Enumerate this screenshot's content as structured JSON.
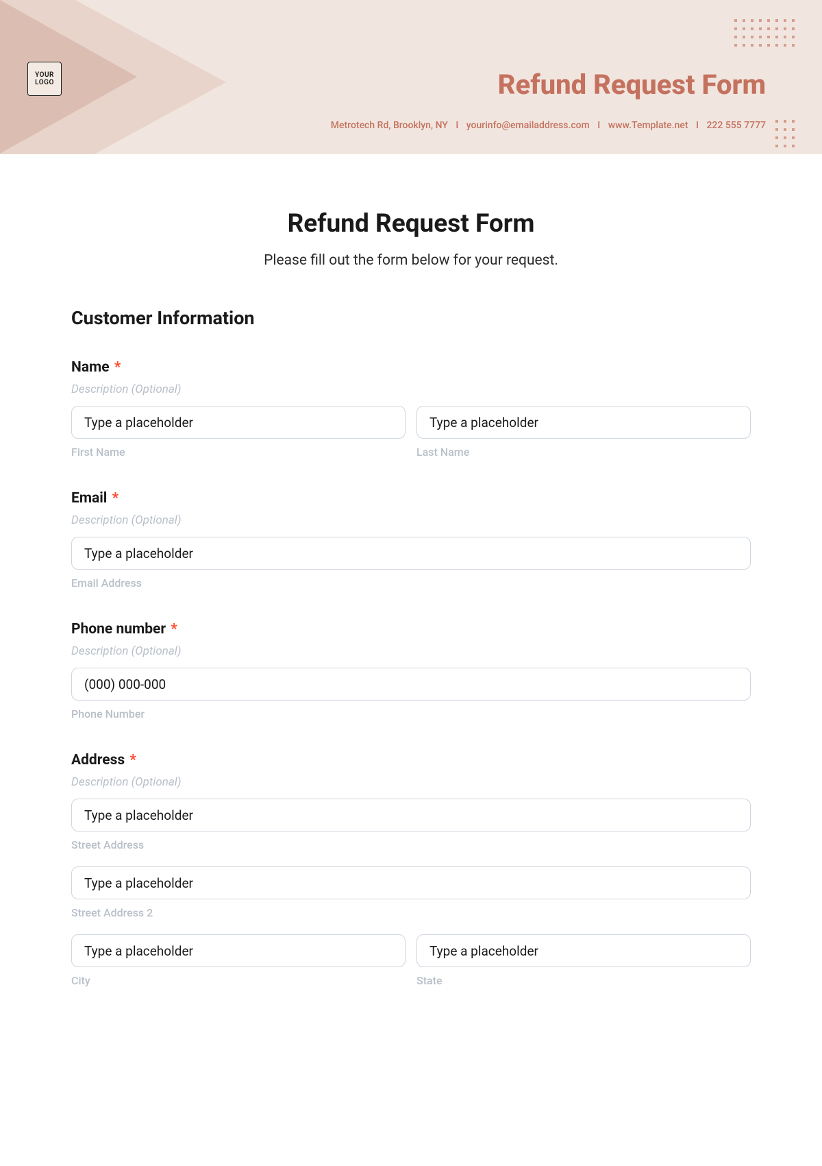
{
  "header": {
    "logo_text": "YOUR LOGO",
    "title": "Refund Request Form",
    "contact": {
      "address": "Metrotech Rd, Brooklyn, NY",
      "email": "yourinfo@emailaddress.com",
      "website": "www.Template.net",
      "phone": "222 555 7777"
    }
  },
  "form": {
    "title": "Refund Request Form",
    "subtitle": "Please fill out the form below for your request.",
    "section_customer": "Customer Information",
    "desc_optional": "Description (Optional)",
    "placeholder_generic": "Type a placeholder",
    "fields": {
      "name": {
        "label": "Name",
        "first_sub": "First Name",
        "last_sub": "Last Name"
      },
      "email": {
        "label": "Email",
        "sub": "Email Address"
      },
      "phone": {
        "label": "Phone number",
        "placeholder": "(000) 000-000",
        "sub": "Phone Number"
      },
      "address": {
        "label": "Address",
        "street_sub": "Street Address",
        "street2_sub": "Street Address 2",
        "city_sub": "City",
        "state_sub": "State"
      }
    }
  }
}
